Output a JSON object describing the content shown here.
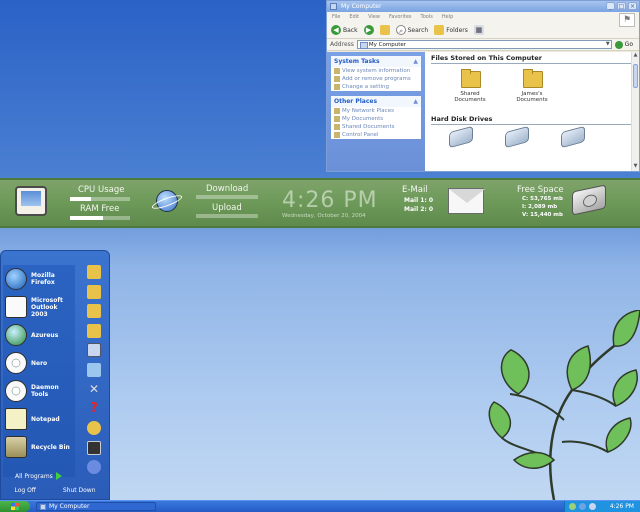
{
  "explorer": {
    "title": "My Computer",
    "menu": [
      "File",
      "Edit",
      "View",
      "Favorites",
      "Tools",
      "Help"
    ],
    "toolbar": {
      "back": "Back",
      "search": "Search",
      "folders": "Folders"
    },
    "address": {
      "label": "Address",
      "value": "My Computer",
      "go": "Go"
    },
    "system_tasks": {
      "title": "System Tasks",
      "items": [
        "View system information",
        "Add or remove programs",
        "Change a setting"
      ]
    },
    "other_places": {
      "title": "Other Places",
      "items": [
        "My Network Places",
        "My Documents",
        "Shared Documents",
        "Control Panel"
      ]
    },
    "files_header": "Files Stored on This Computer",
    "folders": [
      "Shared Documents",
      "James's Documents"
    ],
    "drives_header": "Hard Disk Drives"
  },
  "bar": {
    "cpu_label": "CPU Usage",
    "cpu_level": 0.35,
    "ram_label": "RAM Free",
    "ram_level": 0.55,
    "download_label": "Download",
    "upload_label": "Upload",
    "time": "4:26 PM",
    "date": "Wednesday, October 20, 2004",
    "email_label": "E-Mail",
    "mail_1": "Mail 1: 0",
    "mail_2": "Mail 2: 0",
    "free_space_label": "Free Space",
    "drive_c": "C: 53,765 mb",
    "drive_i": "I: 2,089 mb",
    "drive_v": "V: 15,440 mb"
  },
  "start_menu": {
    "programs": [
      {
        "label": "Mozilla Firefox",
        "icon": "firefox-icon"
      },
      {
        "label": "Microsoft Outlook 2003",
        "icon": "outlook-icon"
      },
      {
        "label": "Azureus",
        "icon": "azureus-icon"
      },
      {
        "label": "Nero",
        "icon": "nero-icon"
      },
      {
        "label": "Daemon Tools",
        "icon": "daemon-tools-icon"
      },
      {
        "label": "Notepad",
        "icon": "notepad-icon"
      },
      {
        "label": "Recycle Bin",
        "icon": "recycle-bin-icon"
      }
    ],
    "all_programs": "All Programs",
    "log_off": "Log Off",
    "shut_down": "Shut Down"
  },
  "taskbar": {
    "task": "My Computer",
    "clock": "4:26 PM"
  },
  "colors": {
    "desktop_top": "#2a62c6",
    "bar_green": "#6e9a5a",
    "leaf_green": "#6fbf5a"
  }
}
